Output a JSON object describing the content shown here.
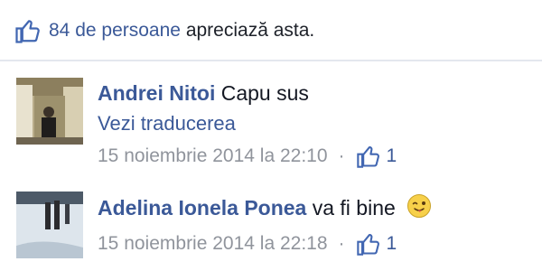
{
  "likes": {
    "count_text": "84 de persoane",
    "rest_text": "apreciază asta."
  },
  "comments": [
    {
      "author": "Andrei Nitoi",
      "text": "Capu sus",
      "translate": "Vezi traducerea",
      "timestamp": "15 noiembrie 2014 la 22:10",
      "separator": "·",
      "like_count": "1",
      "avatar": "photo"
    },
    {
      "author": "Adelina Ionela Ponea",
      "text": "va fi bine",
      "emoji": "wink-tongue-emoji",
      "timestamp": "15 noiembrie 2014 la 22:18",
      "separator": "·",
      "like_count": "1",
      "avatar": "photo"
    }
  ],
  "colors": {
    "link": "#3b5998",
    "meta": "#90949c",
    "text": "#141823"
  },
  "icons": {
    "like": "thumbs-up-icon"
  }
}
